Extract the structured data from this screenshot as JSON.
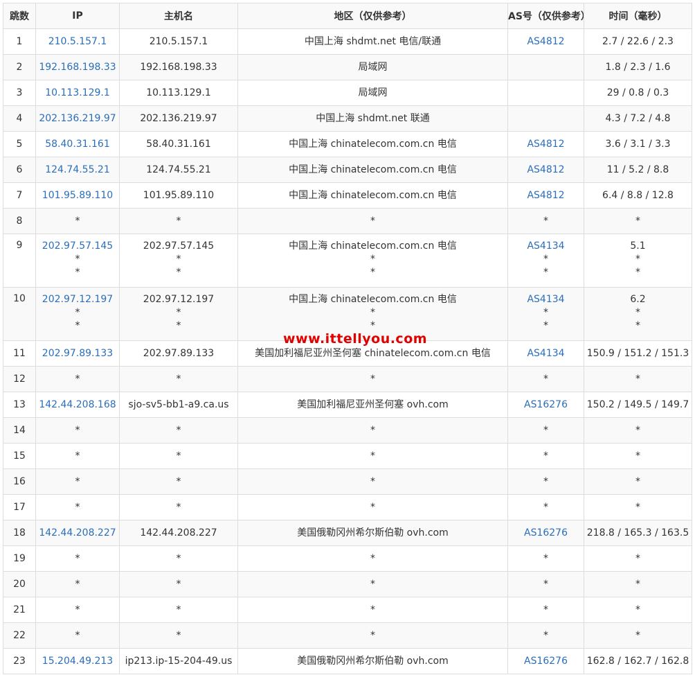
{
  "table": {
    "headers": {
      "hop": "跳数",
      "ip": "IP",
      "host": "主机名",
      "region": "地区（仅供参考）",
      "as": "AS号（仅供参考）",
      "time": "时间（毫秒）"
    },
    "rows": [
      {
        "hop": "1",
        "ip": [
          "210.5.157.1"
        ],
        "host": [
          "210.5.157.1"
        ],
        "region": [
          "中国上海 shdmt.net 电信/联通"
        ],
        "as": [
          "AS4812"
        ],
        "time": [
          "2.7 / 22.6 / 2.3"
        ]
      },
      {
        "hop": "2",
        "ip": [
          "192.168.198.33"
        ],
        "host": [
          "192.168.198.33"
        ],
        "region": [
          "局域网"
        ],
        "as": [
          ""
        ],
        "time": [
          "1.8 / 2.3 / 1.6"
        ]
      },
      {
        "hop": "3",
        "ip": [
          "10.113.129.1"
        ],
        "host": [
          "10.113.129.1"
        ],
        "region": [
          "局域网"
        ],
        "as": [
          ""
        ],
        "time": [
          "29 / 0.8 / 0.3"
        ]
      },
      {
        "hop": "4",
        "ip": [
          "202.136.219.97"
        ],
        "host": [
          "202.136.219.97"
        ],
        "region": [
          "中国上海 shdmt.net 联通"
        ],
        "as": [
          ""
        ],
        "time": [
          "4.3 / 7.2 / 4.8"
        ]
      },
      {
        "hop": "5",
        "ip": [
          "58.40.31.161"
        ],
        "host": [
          "58.40.31.161"
        ],
        "region": [
          "中国上海 chinatelecom.com.cn 电信"
        ],
        "as": [
          "AS4812"
        ],
        "time": [
          "3.6 / 3.1 / 3.3"
        ]
      },
      {
        "hop": "6",
        "ip": [
          "124.74.55.21"
        ],
        "host": [
          "124.74.55.21"
        ],
        "region": [
          "中国上海 chinatelecom.com.cn 电信"
        ],
        "as": [
          "AS4812"
        ],
        "time": [
          "11 / 5.2 / 8.8"
        ]
      },
      {
        "hop": "7",
        "ip": [
          "101.95.89.110"
        ],
        "host": [
          "101.95.89.110"
        ],
        "region": [
          "中国上海 chinatelecom.com.cn 电信"
        ],
        "as": [
          "AS4812"
        ],
        "time": [
          "6.4 / 8.8 / 12.8"
        ]
      },
      {
        "hop": "8",
        "ip": [
          "*"
        ],
        "host": [
          "*"
        ],
        "region": [
          "*"
        ],
        "as": [
          "*"
        ],
        "time": [
          "*"
        ]
      },
      {
        "hop": "9",
        "ip": [
          "202.97.57.145",
          "*",
          "*"
        ],
        "host": [
          "202.97.57.145",
          "*",
          "*"
        ],
        "region": [
          "中国上海 chinatelecom.com.cn 电信",
          "*",
          "*"
        ],
        "as": [
          "AS4134",
          "*",
          "*"
        ],
        "time": [
          "5.1",
          "*",
          "*"
        ]
      },
      {
        "hop": "10",
        "ip": [
          "202.97.12.197",
          "*",
          "*"
        ],
        "host": [
          "202.97.12.197",
          "*",
          "*"
        ],
        "region": [
          "中国上海 chinatelecom.com.cn 电信",
          "*",
          "*"
        ],
        "as": [
          "AS4134",
          "*",
          "*"
        ],
        "time": [
          "6.2",
          "*",
          "*"
        ]
      },
      {
        "hop": "11",
        "ip": [
          "202.97.89.133"
        ],
        "host": [
          "202.97.89.133"
        ],
        "region": [
          "美国加利福尼亚州圣何塞 chinatelecom.com.cn 电信"
        ],
        "as": [
          "AS4134"
        ],
        "time": [
          "150.9 / 151.2 / 151.3"
        ]
      },
      {
        "hop": "12",
        "ip": [
          "*"
        ],
        "host": [
          "*"
        ],
        "region": [
          "*"
        ],
        "as": [
          "*"
        ],
        "time": [
          "*"
        ]
      },
      {
        "hop": "13",
        "ip": [
          "142.44.208.168"
        ],
        "host": [
          "sjo-sv5-bb1-a9.ca.us"
        ],
        "region": [
          "美国加利福尼亚州圣何塞 ovh.com"
        ],
        "as": [
          "AS16276"
        ],
        "time": [
          "150.2 / 149.5 / 149.7"
        ]
      },
      {
        "hop": "14",
        "ip": [
          "*"
        ],
        "host": [
          "*"
        ],
        "region": [
          "*"
        ],
        "as": [
          "*"
        ],
        "time": [
          "*"
        ]
      },
      {
        "hop": "15",
        "ip": [
          "*"
        ],
        "host": [
          "*"
        ],
        "region": [
          "*"
        ],
        "as": [
          "*"
        ],
        "time": [
          "*"
        ]
      },
      {
        "hop": "16",
        "ip": [
          "*"
        ],
        "host": [
          "*"
        ],
        "region": [
          "*"
        ],
        "as": [
          "*"
        ],
        "time": [
          "*"
        ]
      },
      {
        "hop": "17",
        "ip": [
          "*"
        ],
        "host": [
          "*"
        ],
        "region": [
          "*"
        ],
        "as": [
          "*"
        ],
        "time": [
          "*"
        ]
      },
      {
        "hop": "18",
        "ip": [
          "142.44.208.227"
        ],
        "host": [
          "142.44.208.227"
        ],
        "region": [
          "美国俄勒冈州希尔斯伯勒 ovh.com"
        ],
        "as": [
          "AS16276"
        ],
        "time": [
          "218.8 / 165.3 / 163.5"
        ]
      },
      {
        "hop": "19",
        "ip": [
          "*"
        ],
        "host": [
          "*"
        ],
        "region": [
          "*"
        ],
        "as": [
          "*"
        ],
        "time": [
          "*"
        ]
      },
      {
        "hop": "20",
        "ip": [
          "*"
        ],
        "host": [
          "*"
        ],
        "region": [
          "*"
        ],
        "as": [
          "*"
        ],
        "time": [
          "*"
        ]
      },
      {
        "hop": "21",
        "ip": [
          "*"
        ],
        "host": [
          "*"
        ],
        "region": [
          "*"
        ],
        "as": [
          "*"
        ],
        "time": [
          "*"
        ]
      },
      {
        "hop": "22",
        "ip": [
          "*"
        ],
        "host": [
          "*"
        ],
        "region": [
          "*"
        ],
        "as": [
          "*"
        ],
        "time": [
          "*"
        ]
      },
      {
        "hop": "23",
        "ip": [
          "15.204.49.213"
        ],
        "host": [
          "ip213.ip-15-204-49.us"
        ],
        "region": [
          "美国俄勒冈州希尔斯伯勒 ovh.com"
        ],
        "as": [
          "AS16276"
        ],
        "time": [
          "162.8 / 162.7 / 162.8"
        ]
      }
    ]
  },
  "watermark": "www.ittellyou.com",
  "colors": {
    "link": "#2a6ebb",
    "border": "#dddddd",
    "stripe": "#f9f9f9",
    "watermark": "#e00000"
  }
}
